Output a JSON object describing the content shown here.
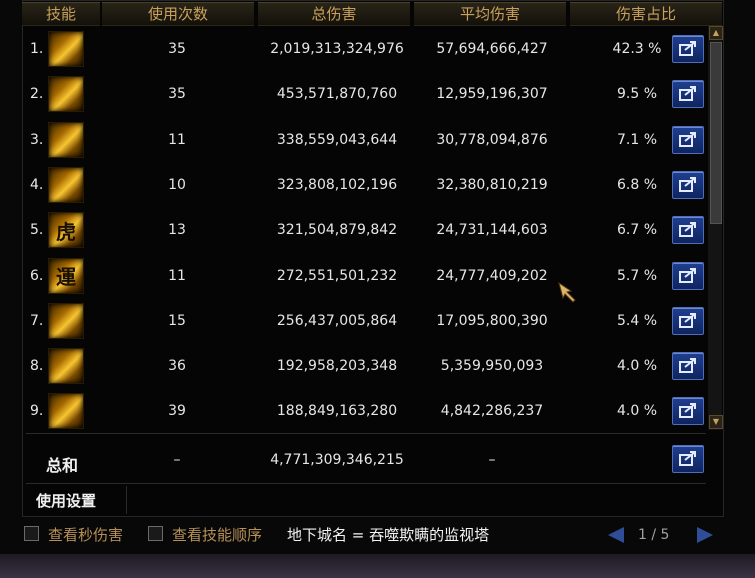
{
  "header": {
    "col_skill": "技能",
    "col_uses": "使用次数",
    "col_total": "总伤害",
    "col_avg": "平均伤害",
    "col_pct": "伤害占比"
  },
  "rows": [
    {
      "rank": "1.",
      "uses": "35",
      "total": "2,019,313,324,976",
      "avg": "57,694,666,427",
      "pct": "42.3 %",
      "icon": "skill-icon-claw"
    },
    {
      "rank": "2.",
      "uses": "35",
      "total": "453,571,870,760",
      "avg": "12,959,196,307",
      "pct": "9.5 %",
      "icon": "skill-icon-fist"
    },
    {
      "rank": "3.",
      "uses": "11",
      "total": "338,559,043,644",
      "avg": "30,778,094,876",
      "pct": "7.1 %",
      "icon": "skill-icon-dragon"
    },
    {
      "rank": "4.",
      "uses": "10",
      "total": "323,808,102,196",
      "avg": "32,380,810,219",
      "pct": "6.8 %",
      "icon": "skill-icon-slash"
    },
    {
      "rank": "5.",
      "uses": "13",
      "total": "321,504,879,842",
      "avg": "24,731,144,603",
      "pct": "6.7 %",
      "icon": "skill-icon-tiger"
    },
    {
      "rank": "6.",
      "uses": "11",
      "total": "272,551,501,232",
      "avg": "24,777,409,202",
      "pct": "5.7 %",
      "icon": "skill-icon-fortune"
    },
    {
      "rank": "7.",
      "uses": "15",
      "total": "256,437,005,864",
      "avg": "17,095,800,390",
      "pct": "5.4 %",
      "icon": "skill-icon-burst"
    },
    {
      "rank": "8.",
      "uses": "36",
      "total": "192,958,203,348",
      "avg": "5,359,950,093",
      "pct": "4.0 %",
      "icon": "skill-icon-wave"
    },
    {
      "rank": "9.",
      "uses": "39",
      "total": "188,849,163,280",
      "avg": "4,842,286,237",
      "pct": "4.0 %",
      "icon": "skill-icon-spiral"
    }
  ],
  "icon_glyphs": [
    "",
    "",
    "",
    "",
    "虎",
    "運",
    "",
    "",
    ""
  ],
  "total": {
    "label": "总和",
    "uses": "–",
    "total": "4,771,309,346,215",
    "avg": "–"
  },
  "settings": {
    "label": "使用设置"
  },
  "footer": {
    "check_dps": "查看秒伤害",
    "check_order": "查看技能顺序",
    "dungeon": "地下城名 = 吞噬欺瞒的监视塔",
    "page": "1 / 5"
  },
  "colors": {
    "header_gold": "#c8a15a",
    "share_blue": "#1f3f8f",
    "checkbox_label": "#b79055"
  }
}
